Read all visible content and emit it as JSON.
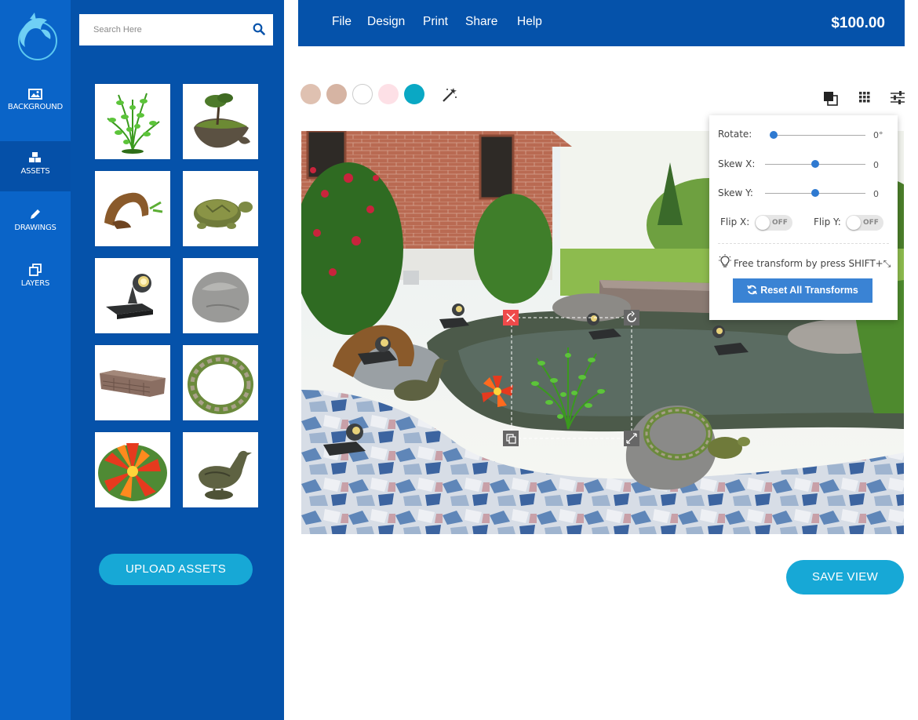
{
  "sidebar": {
    "items": [
      {
        "label": "BACKGROUND",
        "icon": "image-icon"
      },
      {
        "label": "ASSETS",
        "icon": "cubes-icon"
      },
      {
        "label": "DRAWINGS",
        "icon": "pencil-icon"
      },
      {
        "label": "LAYERS",
        "icon": "layers-icon"
      }
    ],
    "active_index": 1
  },
  "search": {
    "placeholder": "Search Here"
  },
  "assets": {
    "tiles": [
      "aquatic-plant",
      "floating-island",
      "driftwood-arch",
      "turtle",
      "pond-light",
      "rock",
      "stone-wall",
      "pebble-ring",
      "water-lily",
      "duck-statue"
    ],
    "upload_label": "UPLOAD ASSETS"
  },
  "menu": {
    "items": [
      "File",
      "Design",
      "Print",
      "Share",
      "Help"
    ]
  },
  "price": "$100.00",
  "swatches": [
    "#dfc1b1",
    "#d6b4a3",
    "#ffffff",
    "#fde0e6",
    "#0aa8c4"
  ],
  "toolbar_icons": [
    "magic-wand-icon",
    "arrange-icon",
    "grid-icon",
    "sliders-icon"
  ],
  "transform": {
    "rotate_label": "Rotate:",
    "rotate_value": "0°",
    "rotate_level": 0,
    "skewx_label": "Skew X:",
    "skewx_value": "0",
    "skewx_level": 0.5,
    "skewy_label": "Skew Y:",
    "skewy_value": "0",
    "skewy_level": 0.5,
    "flipx_label": "Flip X:",
    "flipy_label": "Flip Y:",
    "toggle_state": "OFF",
    "hint": "Free transform by press SHIFT+⤡",
    "reset_label": "Reset All Transforms"
  },
  "save_label": "SAVE VIEW",
  "colors": {
    "rail": "#0a64c8",
    "panel": "#0552aa",
    "accent": "#17a8d6",
    "button": "#3a83d4",
    "delete": "#ef4a4a"
  }
}
